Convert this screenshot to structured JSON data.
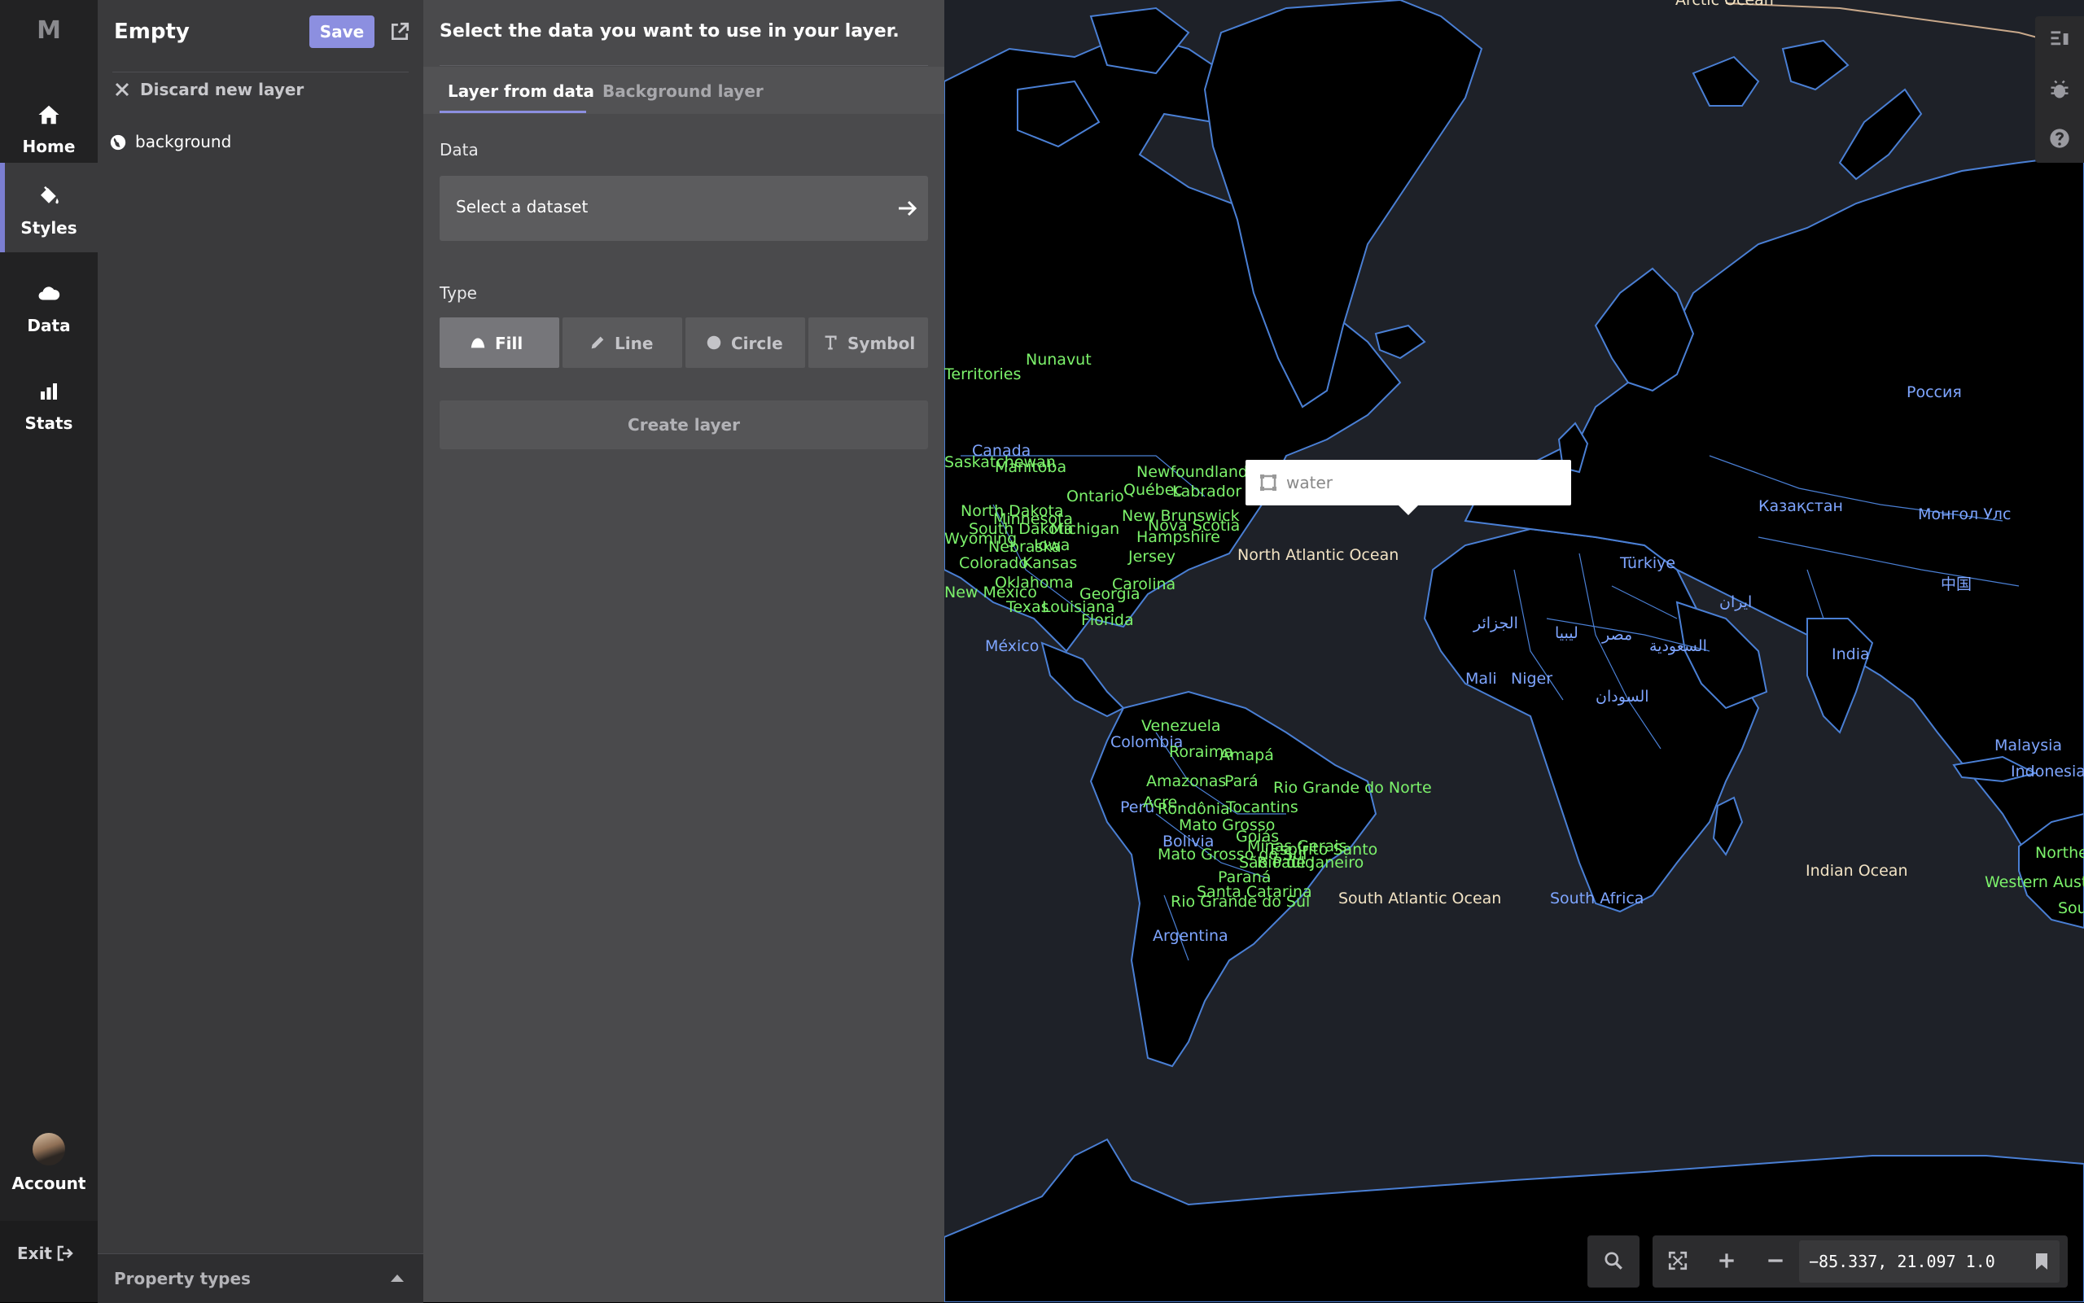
{
  "app": {
    "logo": "M"
  },
  "nav": {
    "items": [
      {
        "label": "Home",
        "icon": "home-icon"
      },
      {
        "label": "Styles",
        "icon": "paint-bucket-icon",
        "active": true
      },
      {
        "label": "Data",
        "icon": "cloud-icon"
      },
      {
        "label": "Stats",
        "icon": "bar-chart-icon"
      }
    ],
    "account_label": "Account",
    "exit_label": "Exit"
  },
  "layers_panel": {
    "title": "Empty",
    "save_label": "Save",
    "discard_label": "Discard new layer",
    "layers": [
      {
        "name": "background",
        "icon": "globe-icon"
      }
    ],
    "property_types_label": "Property types"
  },
  "new_layer": {
    "heading": "Select the data you want to use in your layer.",
    "tabs": [
      {
        "label": "Layer from data",
        "active": true
      },
      {
        "label": "Background layer"
      }
    ],
    "data_label": "Data",
    "dataset_placeholder": "Select a dataset",
    "type_label": "Type",
    "types": [
      {
        "label": "Fill",
        "icon": "fill-icon",
        "active": true
      },
      {
        "label": "Line",
        "icon": "pencil-icon"
      },
      {
        "label": "Circle",
        "icon": "circle-icon"
      },
      {
        "label": "Symbol",
        "icon": "text-symbol-icon"
      }
    ],
    "create_label": "Create layer"
  },
  "map": {
    "tooltip_label": "water",
    "coords_readout": "−85.337, 21.097 1.0",
    "colors": {
      "land": "#000000",
      "water": "#1e2128",
      "border": "#4a7fd4",
      "label_green": "#7cf26b",
      "label_blue": "#7ea5ff",
      "label_ocean": "#f2e3c4",
      "label_white": "#ffffff"
    },
    "labels": {
      "arctic": "Arctic Ocean",
      "nunavut": "Nunavut",
      "territories": "Territories",
      "canada": "Canada",
      "saskatchewan": "Saskatchewan",
      "manitoba": "Manitoba",
      "ontario": "Ontario",
      "quebec": "Québec",
      "newfoundland": "Newfoundland",
      "labrador": "Labrador",
      "new_brunswick": "New Brunswick",
      "nova_scotia": "Nova Scotia",
      "hampshire": "Hampshire",
      "north_dakota": "North Dakota",
      "minnesota": "Minnesota",
      "south_dakota": "South Dakota",
      "michigan": "Michigan",
      "wyoming": "Wyoming",
      "nebraska": "Nebraska",
      "iowa": "Iowa",
      "colorado": "Colorado",
      "kansas": "Kansas",
      "oklahoma": "Oklahoma",
      "new_mexico": "New Mexico",
      "texas": "Texas",
      "louisiana": "Louisiana",
      "carolina": "Carolina",
      "georgia": "Georgia",
      "florida": "Florida",
      "jersey": "Jersey",
      "mexico": "México",
      "north_atlantic": "North Atlantic Ocean",
      "venezuela": "Venezuela",
      "colombia": "Colombia",
      "roraima": "Roraima",
      "amapa": "Amapá",
      "amazonas": "Amazonas",
      "para": "Pará",
      "peru": "Perú",
      "acre": "Acre",
      "rondonia": "Rondônia",
      "tocantins": "Tocantins",
      "rio_grande_norte": "Rio Grande do Norte",
      "mato_grosso": "Mato Grosso",
      "bolivia": "Bolivia",
      "goias": "Goiás",
      "minas_gerais": "Minas Gerais",
      "mato_grosso_sul": "Mato Grosso do Sul",
      "sao_paulo": "São Paulo",
      "rio_janeiro": "Rio de Janeiro",
      "espirito_santo": "Espírito Santo",
      "parana": "Paraná",
      "santa_catarina": "Santa Catarina",
      "rio_grande_sul": "Rio Grande do Sul",
      "argentina": "Argentina",
      "south_atlantic": "South Atlantic Ocean",
      "russia": "Россия",
      "kazakhstan": "Казақстан",
      "mongolia": "Монгол Улс",
      "turkiye": "Türkiye",
      "china": "中国",
      "iran": "ایران",
      "india": "India",
      "algeria": "الجزائر",
      "libya": "ليبيا",
      "egypt": "مصر",
      "saudi": "السعودية",
      "sudan": "السودان",
      "mali": "Mali",
      "niger": "Niger",
      "south_africa": "South Africa",
      "indian_ocean": "Indian Ocean",
      "malaysia": "Malaysia",
      "indonesia": "Indonesia",
      "northern": "Northe",
      "western_aus": "Western Aust",
      "sou": "Sou"
    }
  }
}
